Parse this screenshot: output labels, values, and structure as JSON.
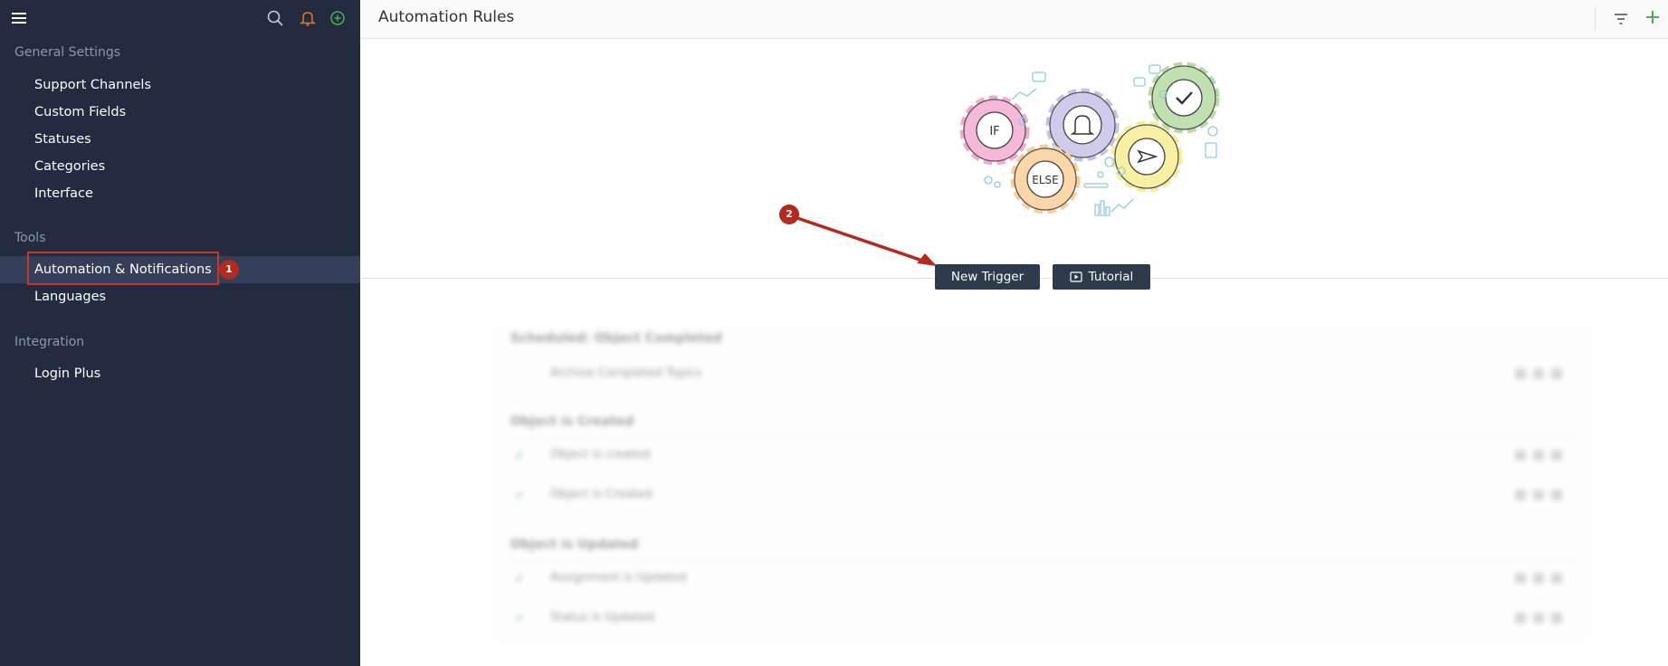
{
  "sidebar": {
    "sections": [
      {
        "title": "General Settings",
        "items": [
          "Support Channels",
          "Custom Fields",
          "Statuses",
          "Categories",
          "Interface"
        ]
      },
      {
        "title": "Tools",
        "items": [
          "Automation & Notifications",
          "Languages"
        ]
      },
      {
        "title": "Integration",
        "items": [
          "Login Plus"
        ]
      }
    ],
    "active_item": "Automation & Notifications"
  },
  "header": {
    "title": "Automation Rules"
  },
  "illustration": {
    "if_label": "IF",
    "else_label": "ELSE"
  },
  "actions": {
    "new_trigger": "New Trigger",
    "tutorial": "Tutorial"
  },
  "annotations": {
    "badge_1": "1",
    "badge_2": "2"
  },
  "rules": {
    "groups": [
      {
        "title": "Scheduled: Object Completed",
        "rows": [
          {
            "name": "Archive Completed Topics",
            "enabled": false
          }
        ]
      },
      {
        "title": "Object is Created",
        "rows": [
          {
            "name": "Object is created",
            "enabled": true
          },
          {
            "name": "Object is Created",
            "enabled": true
          }
        ]
      },
      {
        "title": "Object is Updated",
        "rows": [
          {
            "name": "Assignment is Updated",
            "enabled": true
          },
          {
            "name": "Status is Updated",
            "enabled": true
          }
        ]
      }
    ]
  },
  "colors": {
    "sidebar_bg": "#222b40",
    "active_bg": "#353f59",
    "button_bg": "#2e3b4d",
    "annotation_red": "#b22b1e",
    "bell_icon": "#e8751a",
    "plus_icon": "#4caf50"
  }
}
